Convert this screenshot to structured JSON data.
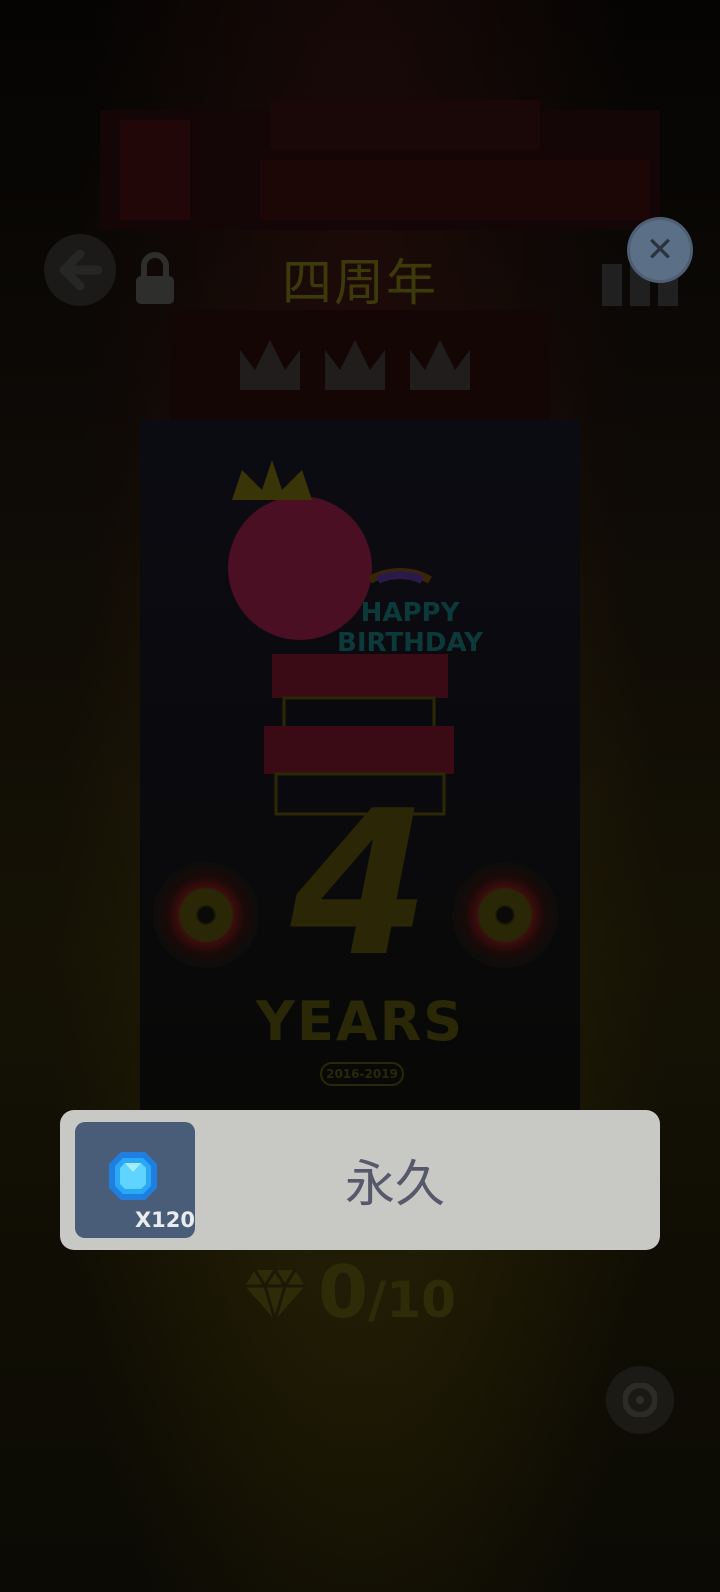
{
  "header": {
    "title": "四周年",
    "back_icon": "arrow-left-icon",
    "lock_icon": "lock-icon",
    "leaderboard_icon": "bar-chart-icon",
    "close_icon": "close-icon"
  },
  "card": {
    "banner_text": "HAPPY BIRTHDAY",
    "number": "4",
    "years_label": "YEARS",
    "years_range": "2016-2019"
  },
  "reward_popup": {
    "item_icon": "blue-gem-icon",
    "item_quantity": "X120",
    "label": "永久"
  },
  "progress": {
    "icon": "diamond-icon",
    "current": "0",
    "separator": "/",
    "total": "10"
  },
  "colors": {
    "popup_bg": "#c8c8c4",
    "item_tile_bg": "#4a5d78",
    "close_btn_bg": "#5b6f86"
  }
}
